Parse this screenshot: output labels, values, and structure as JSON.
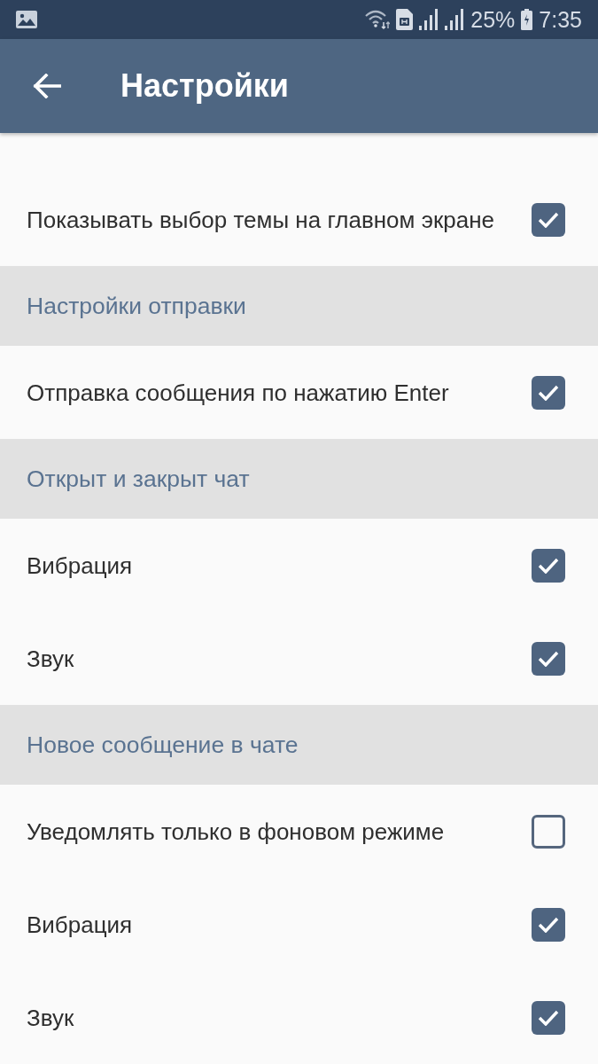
{
  "status_bar": {
    "battery": "25%",
    "time": "7:35"
  },
  "app_bar": {
    "title": "Настройки"
  },
  "items": [
    {
      "kind": "option",
      "label": "Показывать выбор темы на главном экране",
      "checked": true
    },
    {
      "kind": "section",
      "label": "Настройки отправки"
    },
    {
      "kind": "option",
      "label": "Отправка сообщения по нажатию Enter",
      "checked": true
    },
    {
      "kind": "section",
      "label": "Открыт и закрыт чат"
    },
    {
      "kind": "option",
      "label": "Вибрация",
      "checked": true
    },
    {
      "kind": "option",
      "label": "Звук",
      "checked": true
    },
    {
      "kind": "section",
      "label": "Новое сообщение в чате"
    },
    {
      "kind": "option",
      "label": "Уведомлять только в фоновом режиме",
      "checked": false
    },
    {
      "kind": "option",
      "label": "Вибрация",
      "checked": true
    },
    {
      "kind": "option",
      "label": "Звук",
      "checked": true
    }
  ]
}
